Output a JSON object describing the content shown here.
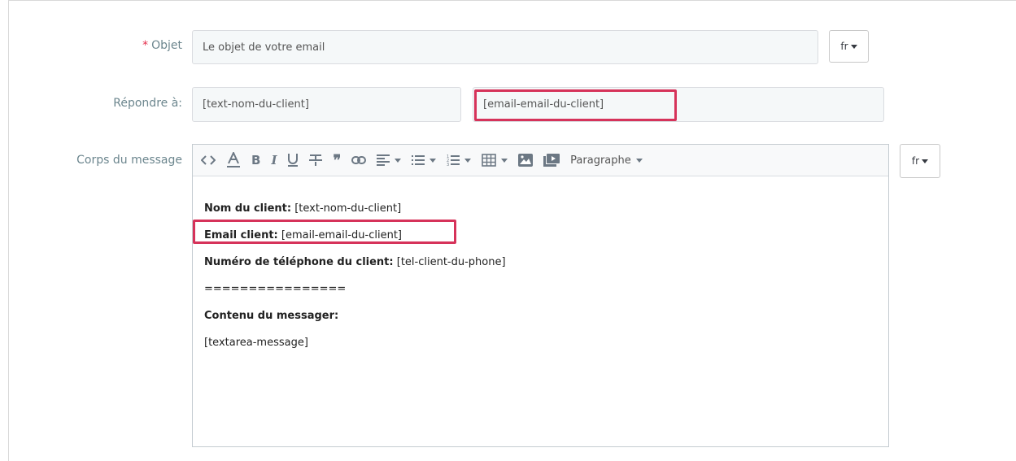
{
  "subject": {
    "label": "Objet",
    "required_mark": "*",
    "value": "Le objet de votre email",
    "lang": "fr"
  },
  "reply_to": {
    "label": "Répondre à:",
    "name_value": "[text-nom-du-client]",
    "email_value": "[email-email-du-client]"
  },
  "body": {
    "label": "Corps du message",
    "lang": "fr",
    "toolbar": {
      "paragraph_label": "Paragraphe",
      "buttons": [
        "code-view",
        "font-color",
        "bold",
        "italic",
        "underline",
        "strikethrough",
        "blockquote",
        "link",
        "align",
        "unordered-list",
        "ordered-list",
        "table",
        "image",
        "video",
        "paragraph-format"
      ]
    },
    "lines": [
      {
        "bold": "Nom du client:",
        "text": " [text-nom-du-client]"
      },
      {
        "bold": "Email client:",
        "text": " [email-email-du-client]"
      },
      {
        "bold": "Numéro de téléphone du client:",
        "text": " [tel-client-du-phone]"
      },
      {
        "bold": "",
        "text": "================"
      },
      {
        "bold": "Contenu du messager:",
        "text": ""
      },
      {
        "bold": "",
        "text": "[textarea-message]"
      }
    ]
  },
  "colors": {
    "highlight": "#d6335a",
    "required": "#e5304d",
    "label": "#6c868e"
  }
}
